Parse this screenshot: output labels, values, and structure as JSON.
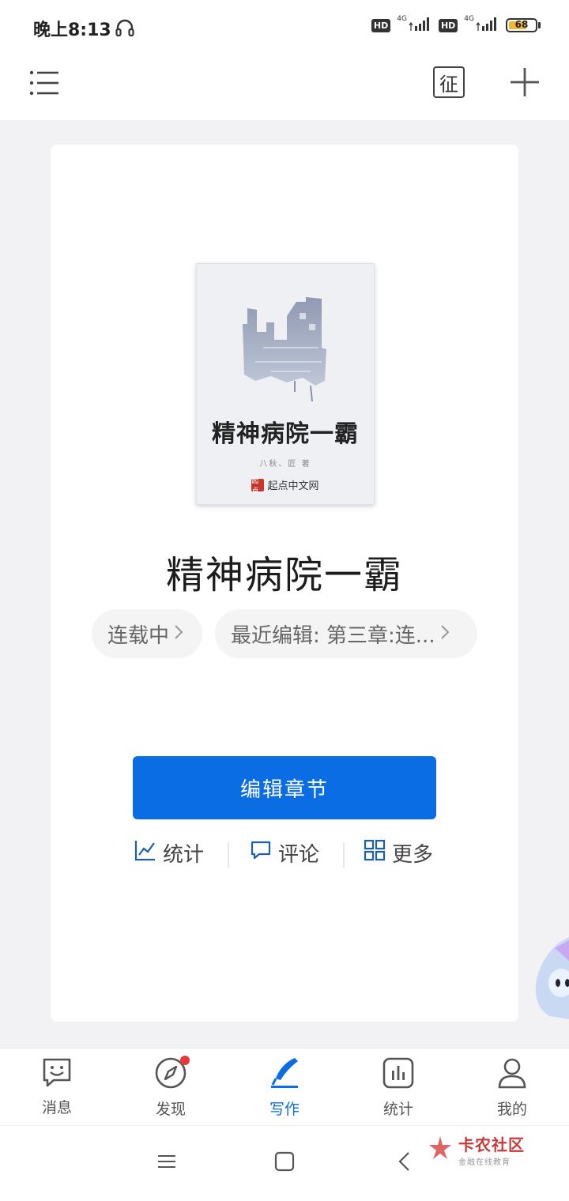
{
  "status_bar": {
    "time": "晚上8:13",
    "hd_label_1": "HD",
    "net_label_1": "4G",
    "hd_label_2": "HD",
    "net_label_2": "4G",
    "battery": "68",
    "battery_level": 0.68
  },
  "topbar": {
    "solicit_label": "征"
  },
  "book": {
    "cover_title": "精神病院一霸",
    "cover_author": "八秋、匠 著",
    "cover_publisher": "起点中文网",
    "cover_publisher_seal": "起点",
    "title": "精神病院一霸",
    "status_chip": "连载中",
    "recent_chip": "最近编辑: 第三章:连..."
  },
  "primary_action": {
    "edit_label": "编辑章节"
  },
  "secondary_actions": {
    "stats_label": "统计",
    "comments_label": "评论",
    "more_label": "更多"
  },
  "tabbar": {
    "items": [
      {
        "label": "消息",
        "icon": "message-smile-icon"
      },
      {
        "label": "发现",
        "icon": "compass-icon",
        "badge": true
      },
      {
        "label": "写作",
        "icon": "pen-icon",
        "active": true
      },
      {
        "label": "统计",
        "icon": "bar-chart-icon"
      },
      {
        "label": "我的",
        "icon": "person-icon"
      }
    ]
  },
  "watermark": {
    "title": "卡农社区",
    "subtitle": "金融在线教育"
  },
  "colors": {
    "accent": "#0a6de3",
    "badge_red": "#e6393b",
    "background": "#f2f2f4",
    "battery_fill": "#f2b632"
  }
}
